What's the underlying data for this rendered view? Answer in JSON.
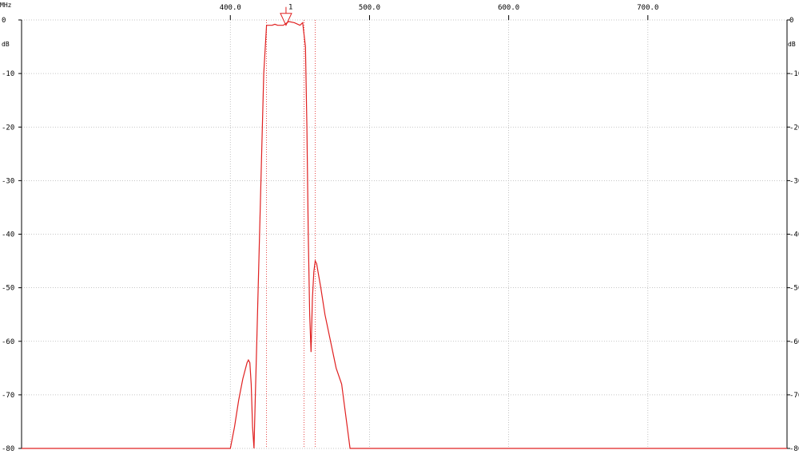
{
  "chart_data": {
    "type": "line",
    "x_unit": "MHz",
    "y_unit": "dB",
    "xlim": [
      250,
      800
    ],
    "ylim": [
      -80,
      0
    ],
    "x_ticks": [
      400,
      500,
      600,
      700
    ],
    "x_tick_labels": [
      "400.0",
      "500.0",
      "600.0",
      "700.0"
    ],
    "y_ticks": [
      0,
      -10,
      -20,
      -30,
      -40,
      -50,
      -60,
      -70,
      -80
    ],
    "y_tick_labels": [
      "0",
      "-10",
      "-20",
      "-30",
      "-40",
      "-50",
      "-60",
      "-70",
      "-80"
    ],
    "grid": true,
    "colors": {
      "trace": "#e02020",
      "grid": "#b4b4b4",
      "marker": "#e02020"
    },
    "series": [
      {
        "x": [
          250,
          400,
          403,
          406,
          409,
          412,
          413,
          414,
          415,
          416,
          417,
          418,
          419,
          422,
          424,
          426,
          428,
          430,
          432,
          434,
          438,
          442,
          446,
          450,
          452,
          454,
          455,
          456,
          457,
          458,
          459,
          460,
          461,
          462,
          463,
          465,
          468,
          472,
          476,
          480,
          482,
          484,
          486,
          487,
          800
        ],
        "y": [
          -80,
          -80,
          -76,
          -71,
          -67,
          -64,
          -63.5,
          -64,
          -68,
          -76,
          -80,
          -70,
          -60,
          -30,
          -10,
          -1,
          -1,
          -1,
          -0.8,
          -1,
          -1,
          -0.3,
          -0.5,
          -1,
          -0.5,
          -5,
          -20,
          -40,
          -55,
          -62,
          -52,
          -47,
          -45,
          -45.5,
          -47,
          -50,
          -55,
          -60,
          -65,
          -68,
          -72,
          -76,
          -80,
          -80,
          -80
        ]
      }
    ],
    "markers": [
      {
        "label": "1",
        "x": 440,
        "y": -1
      }
    ],
    "vertical_lines": [
      426,
      453,
      461
    ]
  }
}
